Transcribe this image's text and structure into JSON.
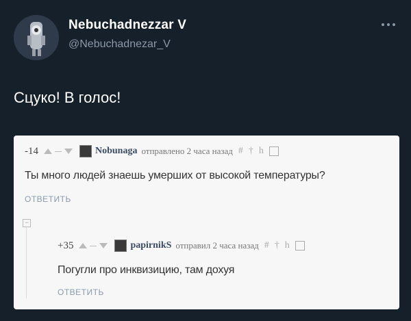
{
  "tweet": {
    "display_name": "Nebuchadnezzar V",
    "handle": "@Nebuchadnezar_V",
    "text": "Сцуко! В голос!",
    "more_icon": "more-horizontal-icon"
  },
  "screenshot": {
    "comments": [
      {
        "score": "-14",
        "username": "Nobunaga",
        "meta": "отправлено 2 часа назад",
        "text": "Ты много людей знаешь умерших от высокой температуры?",
        "reply_label": "ОТВЕТИТЬ"
      },
      {
        "score": "+35",
        "username": "papirnikS",
        "meta": "отправил 2 часа назад",
        "text": "Погугли про инквизицию, там дохуя",
        "reply_label": "ОТВЕТИТЬ"
      }
    ],
    "collapse_symbol": "−",
    "tool_hash": "#",
    "tool_pin": "†",
    "tool_h": "h"
  }
}
